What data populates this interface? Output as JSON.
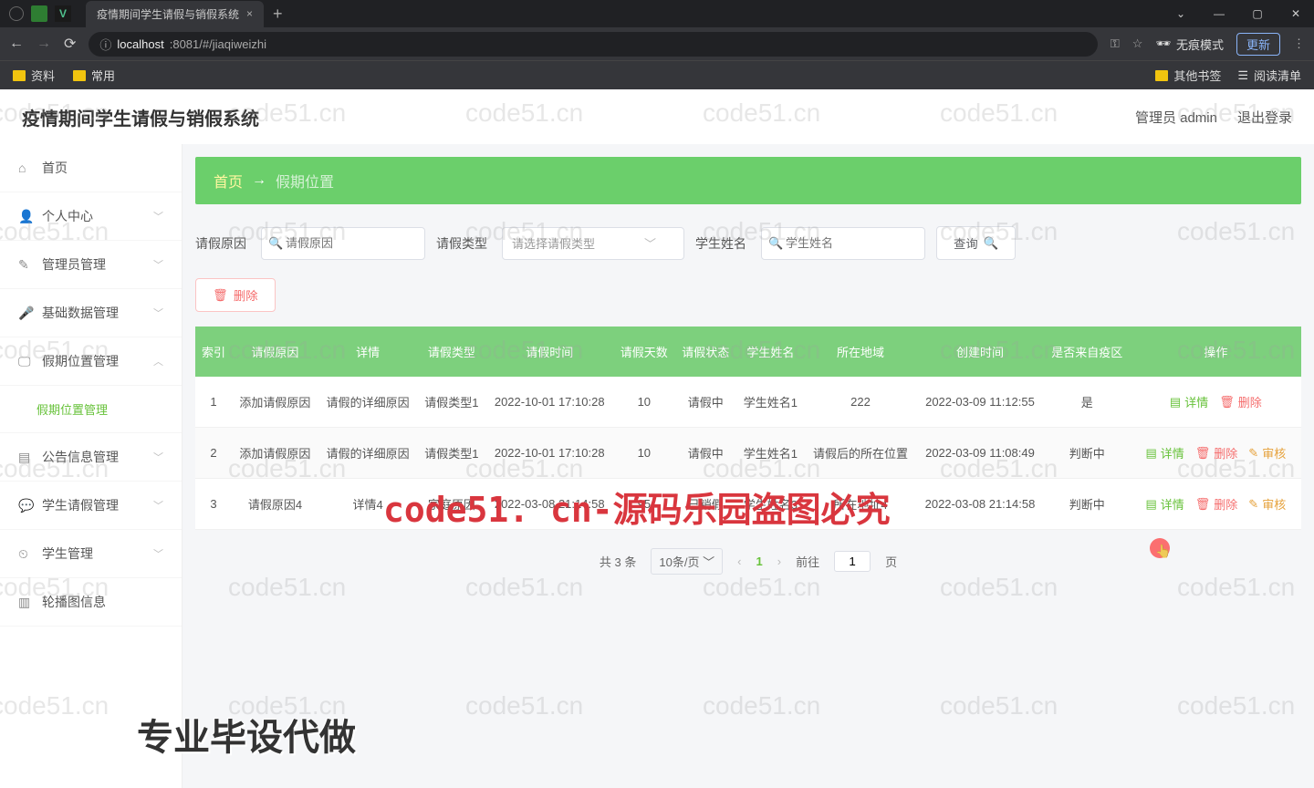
{
  "browser": {
    "tab_title": "疫情期间学生请假与销假系统",
    "url_host": "localhost",
    "url_rest": ":8081/#/jiaqiweizhi",
    "incognito_label": "无痕模式",
    "update_label": "更新",
    "bookmarks": {
      "bm1": "资料",
      "bm2": "常用",
      "other": "其他书签",
      "reading": "阅读清单"
    },
    "win": {
      "min": "—",
      "max": "▢",
      "close": "✕"
    }
  },
  "app": {
    "title": "疫情期间学生请假与销假系统",
    "user_label": "管理员 admin",
    "logout": "退出登录"
  },
  "sidebar": {
    "home": "首页",
    "profile": "个人中心",
    "admin": "管理员管理",
    "base": "基础数据管理",
    "vacation": "假期位置管理",
    "vacation_sub": "假期位置管理",
    "notice": "公告信息管理",
    "leave": "学生请假管理",
    "student": "学生管理",
    "carousel": "轮播图信息"
  },
  "breadcrumb": {
    "home": "首页",
    "arrow": "→",
    "current": "假期位置"
  },
  "filters": {
    "reason_label": "请假原因",
    "reason_ph": "请假原因",
    "type_label": "请假类型",
    "type_ph": "请选择请假类型",
    "name_label": "学生姓名",
    "name_ph": "学生姓名",
    "search": "查询"
  },
  "toolbar": {
    "delete": "删除"
  },
  "table": {
    "headers": [
      "索引",
      "请假原因",
      "详情",
      "请假类型",
      "请假时间",
      "请假天数",
      "请假状态",
      "学生姓名",
      "所在地域",
      "创建时间",
      "是否来自疫区",
      "操作"
    ],
    "rows": [
      {
        "idx": "1",
        "reason": "添加请假原因",
        "detail": "请假的详细原因",
        "type": "请假类型1",
        "time": "2022-10-01 17:10:28",
        "days": "10",
        "status": "请假中",
        "name": "学生姓名1",
        "loc": "222",
        "ctime": "2022-03-09 11:12:55",
        "fromrisk": "是",
        "acts": [
          "detail",
          "delete"
        ]
      },
      {
        "idx": "2",
        "reason": "添加请假原因",
        "detail": "请假的详细原因",
        "type": "请假类型1",
        "time": "2022-10-01 17:10:28",
        "days": "10",
        "status": "请假中",
        "name": "学生姓名1",
        "loc": "请假后的所在位置",
        "ctime": "2022-03-09 11:08:49",
        "fromrisk": "判断中",
        "acts": [
          "detail",
          "delete",
          "audit"
        ]
      },
      {
        "idx": "3",
        "reason": "请假原因4",
        "detail": "详情4",
        "type": "家庭原因",
        "time": "2022-03-08 21:14:58",
        "days": "95",
        "status": "已销假",
        "name": "学生姓名3",
        "loc": "所在地址4",
        "ctime": "2022-03-08 21:14:58",
        "fromrisk": "判断中",
        "acts": [
          "detail",
          "delete",
          "audit"
        ]
      }
    ],
    "act_labels": {
      "detail": "详情",
      "delete": "删除",
      "audit": "审核"
    }
  },
  "pager": {
    "total_prefix": "共",
    "total_num": "3",
    "total_suffix": "条",
    "size": "10条/页",
    "current": "1",
    "goto_prefix": "前往",
    "goto_val": "1",
    "goto_suffix": "页"
  },
  "overlay": {
    "red": "code51. cn-源码乐园盗图必究",
    "bottom": "专业毕设代做",
    "wm": "code51.cn"
  }
}
